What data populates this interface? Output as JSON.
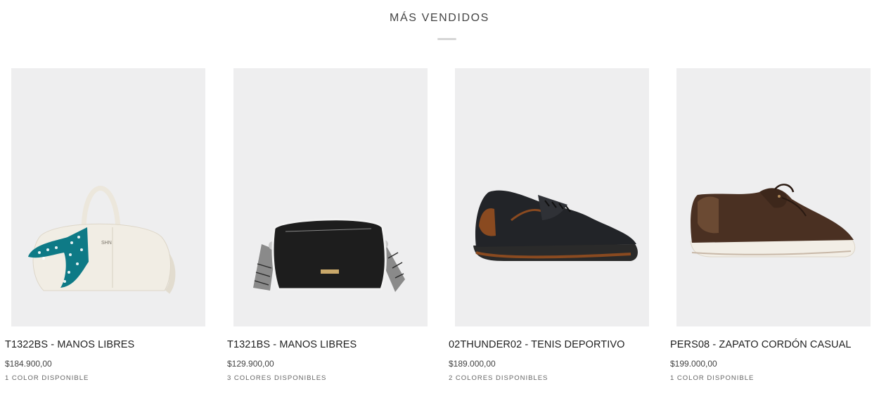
{
  "section": {
    "title": "MÁS VENDIDOS"
  },
  "products": [
    {
      "name": "T1322BS - MANOS LIBRES",
      "price": "$184.900,00",
      "colors": "1 COLOR DISPONIBLE",
      "image_icon": "white-handbag-with-scarf"
    },
    {
      "name": "T1321BS - MANOS LIBRES",
      "price": "$129.900,00",
      "colors": "3 COLORES DISPONIBLES",
      "image_icon": "black-crossbody-bag"
    },
    {
      "name": "02THUNDER02 - TENIS DEPORTIVO",
      "price": "$189.000,00",
      "colors": "2 COLORES DISPONIBLES",
      "image_icon": "black-sneaker"
    },
    {
      "name": "PERS08 - ZAPATO CORDÓN CASUAL",
      "price": "$199.000,00",
      "colors": "1 COLOR DISPONIBLE",
      "image_icon": "brown-casual-shoe"
    }
  ],
  "colors": {
    "image_background": "#eeeeef",
    "bag_white": "#f1ede4",
    "scarf_teal": "#0e7a86",
    "bag_black": "#1d1d1d",
    "sneaker_black": "#222428",
    "sneaker_brown": "#8a4a20",
    "shoe_brown": "#4a3022",
    "sole_cream": "#f2eee6"
  }
}
